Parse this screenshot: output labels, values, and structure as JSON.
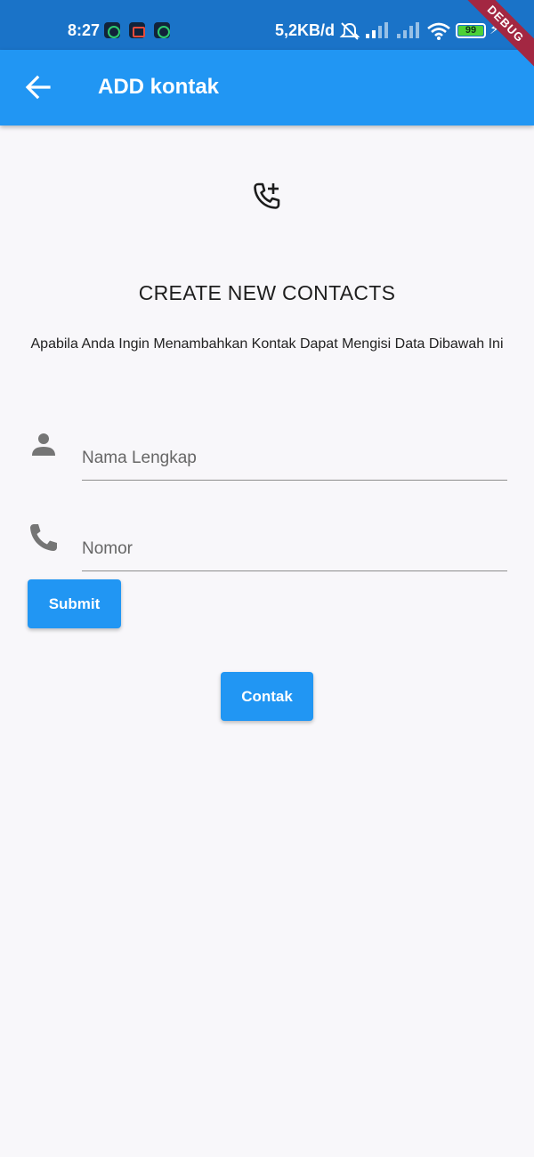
{
  "status_bar": {
    "time": "8:27",
    "speed": "5,2KB/d",
    "battery": "99",
    "icons": [
      "notification-app-icon",
      "notification-record-icon",
      "notification-app-icon",
      "mute-icon",
      "signal-icon",
      "signal-icon",
      "wifi-icon",
      "battery-icon",
      "charging-icon"
    ]
  },
  "debug_banner": "DEBUG",
  "appbar": {
    "title": "ADD kontak",
    "back_icon": "arrow-back-icon"
  },
  "header": {
    "icon": "add-call-icon",
    "heading": "CREATE NEW CONTACTS",
    "subtitle": "Apabila Anda Ingin Menambahkan Kontak Dapat Mengisi Data Dibawah Ini"
  },
  "form": {
    "name": {
      "icon": "person-icon",
      "value": "",
      "placeholder": "Nama Lengkap"
    },
    "phone": {
      "icon": "phone-icon",
      "value": "",
      "placeholder": "Nomor"
    },
    "submit_label": "Submit"
  },
  "contak_button_label": "Contak",
  "colors": {
    "status_bar": "#1a73c8",
    "appbar": "#2196f3",
    "button": "#2196f3",
    "background": "#f8f7fa",
    "debug_ribbon": "#a32742"
  }
}
